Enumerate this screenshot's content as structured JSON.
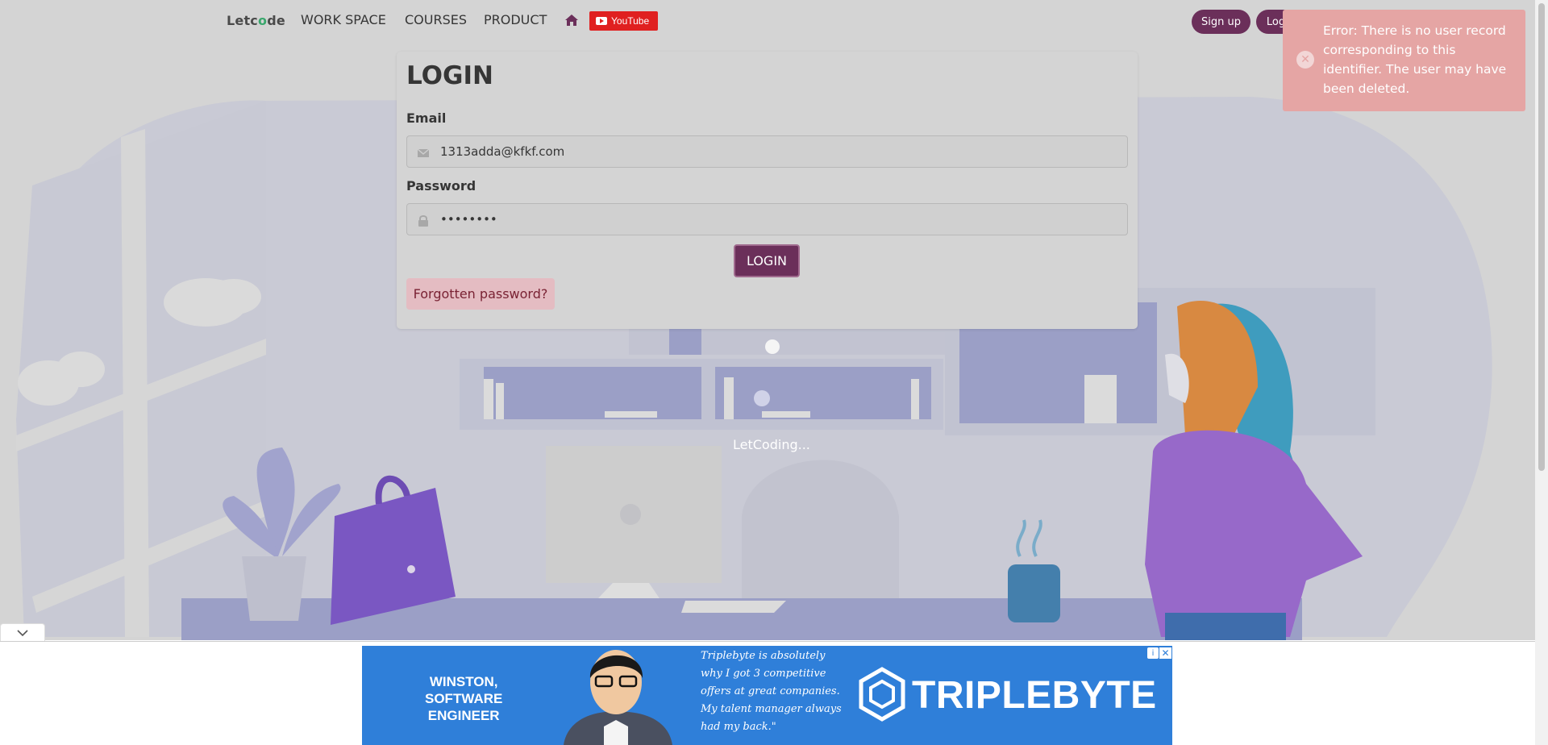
{
  "navbar": {
    "brand_prefix": "Letc",
    "brand_o": "o",
    "brand_suffix": "de",
    "links": [
      "WORK SPACE",
      "COURSES",
      "PRODUCT"
    ],
    "youtube_label": "YouTube",
    "signup_label": "Sign up",
    "login_label": "Log in"
  },
  "login_form": {
    "title": "LOGIN",
    "email_label": "Email",
    "email_value": "1313adda@kfkf.com",
    "password_label": "Password",
    "password_value": "••••••••",
    "submit_label": "LOGIN",
    "forgot_label": "Forgotten password?"
  },
  "toast": {
    "message": "Error: There is no user record corresponding to this identifier. The user may have been deleted."
  },
  "loading_text": "LetCoding...",
  "ad": {
    "person_lines": [
      "WINSTON,",
      "SOFTWARE",
      "ENGINEER"
    ],
    "quote_lines": [
      "Triplebyte is absolutely",
      "why I got 3 competitive",
      "offers at great companies.",
      "My talent manager always",
      "had my back.\""
    ],
    "brand": "TRIPLEBYTE",
    "info_icon": "i",
    "close_icon": "✕"
  },
  "colors": {
    "primary": "#6b2f5a",
    "toast_bg": "#e5a5a4",
    "ad_bg": "#2f7fd9",
    "youtube_red": "#e02020"
  },
  "icons": [
    "home-icon",
    "youtube-icon",
    "envelope-icon",
    "lock-icon",
    "close-circle-icon",
    "chevron-down-icon",
    "info-icon",
    "close-icon"
  ]
}
